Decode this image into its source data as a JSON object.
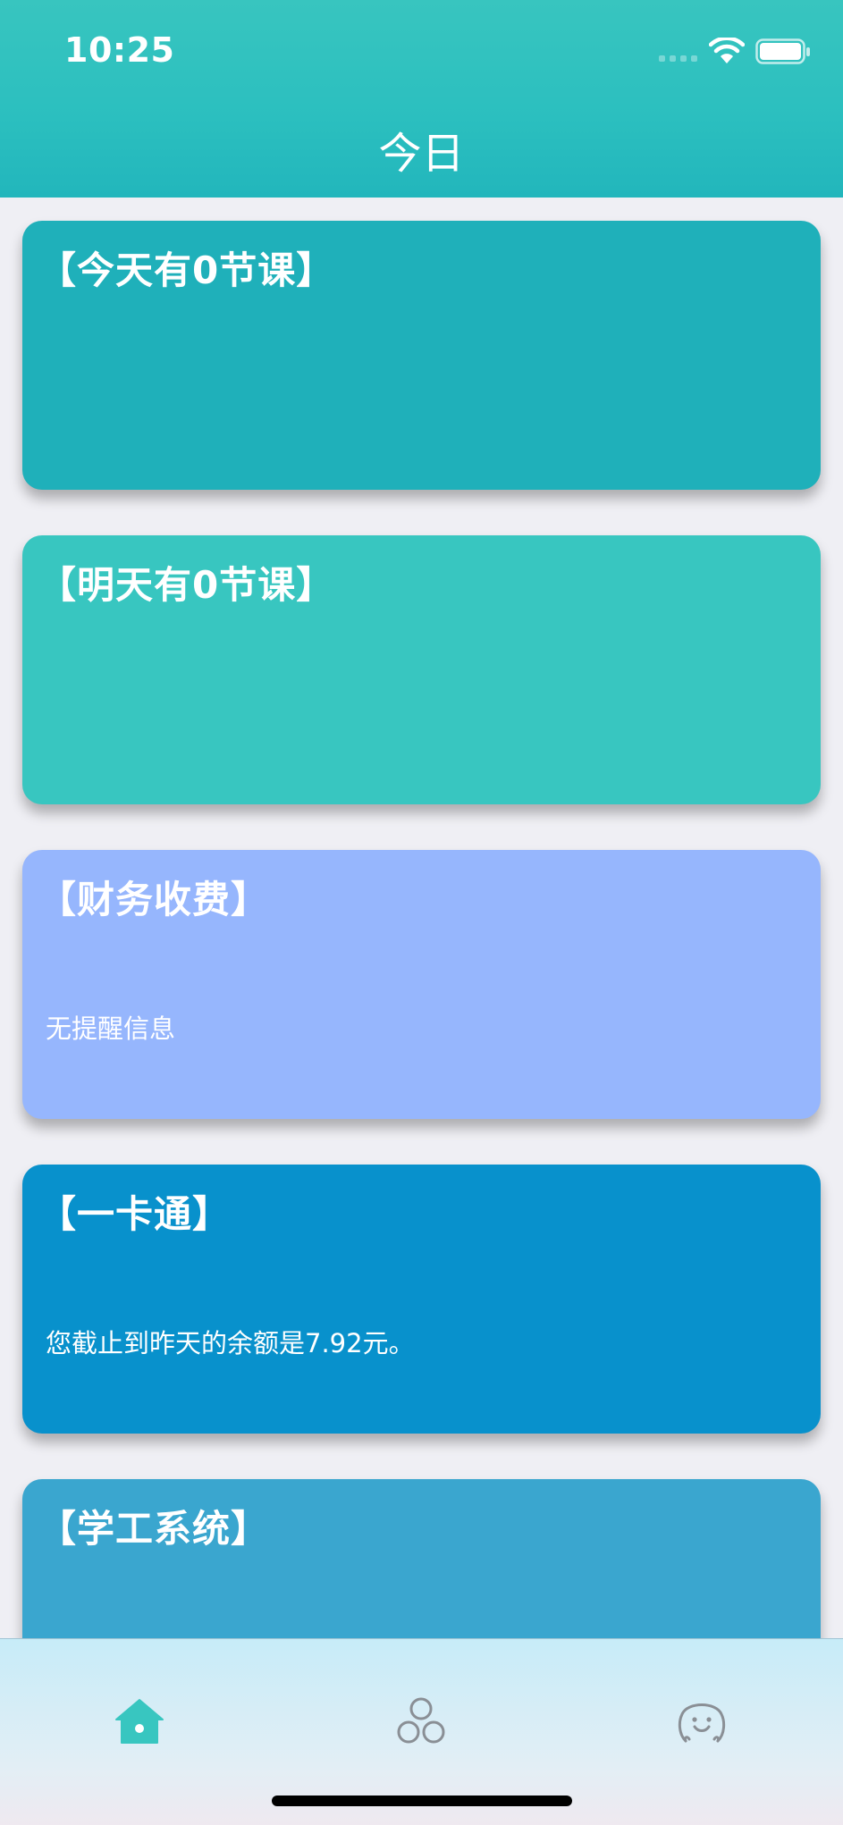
{
  "status_bar": {
    "time": "10:25",
    "icons": [
      "signal-icon",
      "wifi-icon",
      "battery-icon"
    ]
  },
  "nav": {
    "title": "今日"
  },
  "cards": [
    {
      "title": "【今天有0节课】",
      "body": "",
      "color": "#1fb0ba"
    },
    {
      "title": "【明天有0节课】",
      "body": "",
      "color": "#38c6c0"
    },
    {
      "title": "【财务收费】",
      "body": "无提醒信息",
      "color": "#96b6fd"
    },
    {
      "title": "【一卡通】",
      "body": "您截止到昨天的余额是7.92元。",
      "color": "#0891cc"
    },
    {
      "title": "【学工系统】",
      "body": "",
      "color": "#3aa6cf"
    }
  ],
  "tabbar": {
    "tabs": [
      {
        "icon": "home-icon",
        "active": true
      },
      {
        "icon": "circles-icon",
        "active": false
      },
      {
        "icon": "face-icon",
        "active": false
      }
    ],
    "active_color": "#38c6c0",
    "inactive_color": "#8a8f95"
  }
}
